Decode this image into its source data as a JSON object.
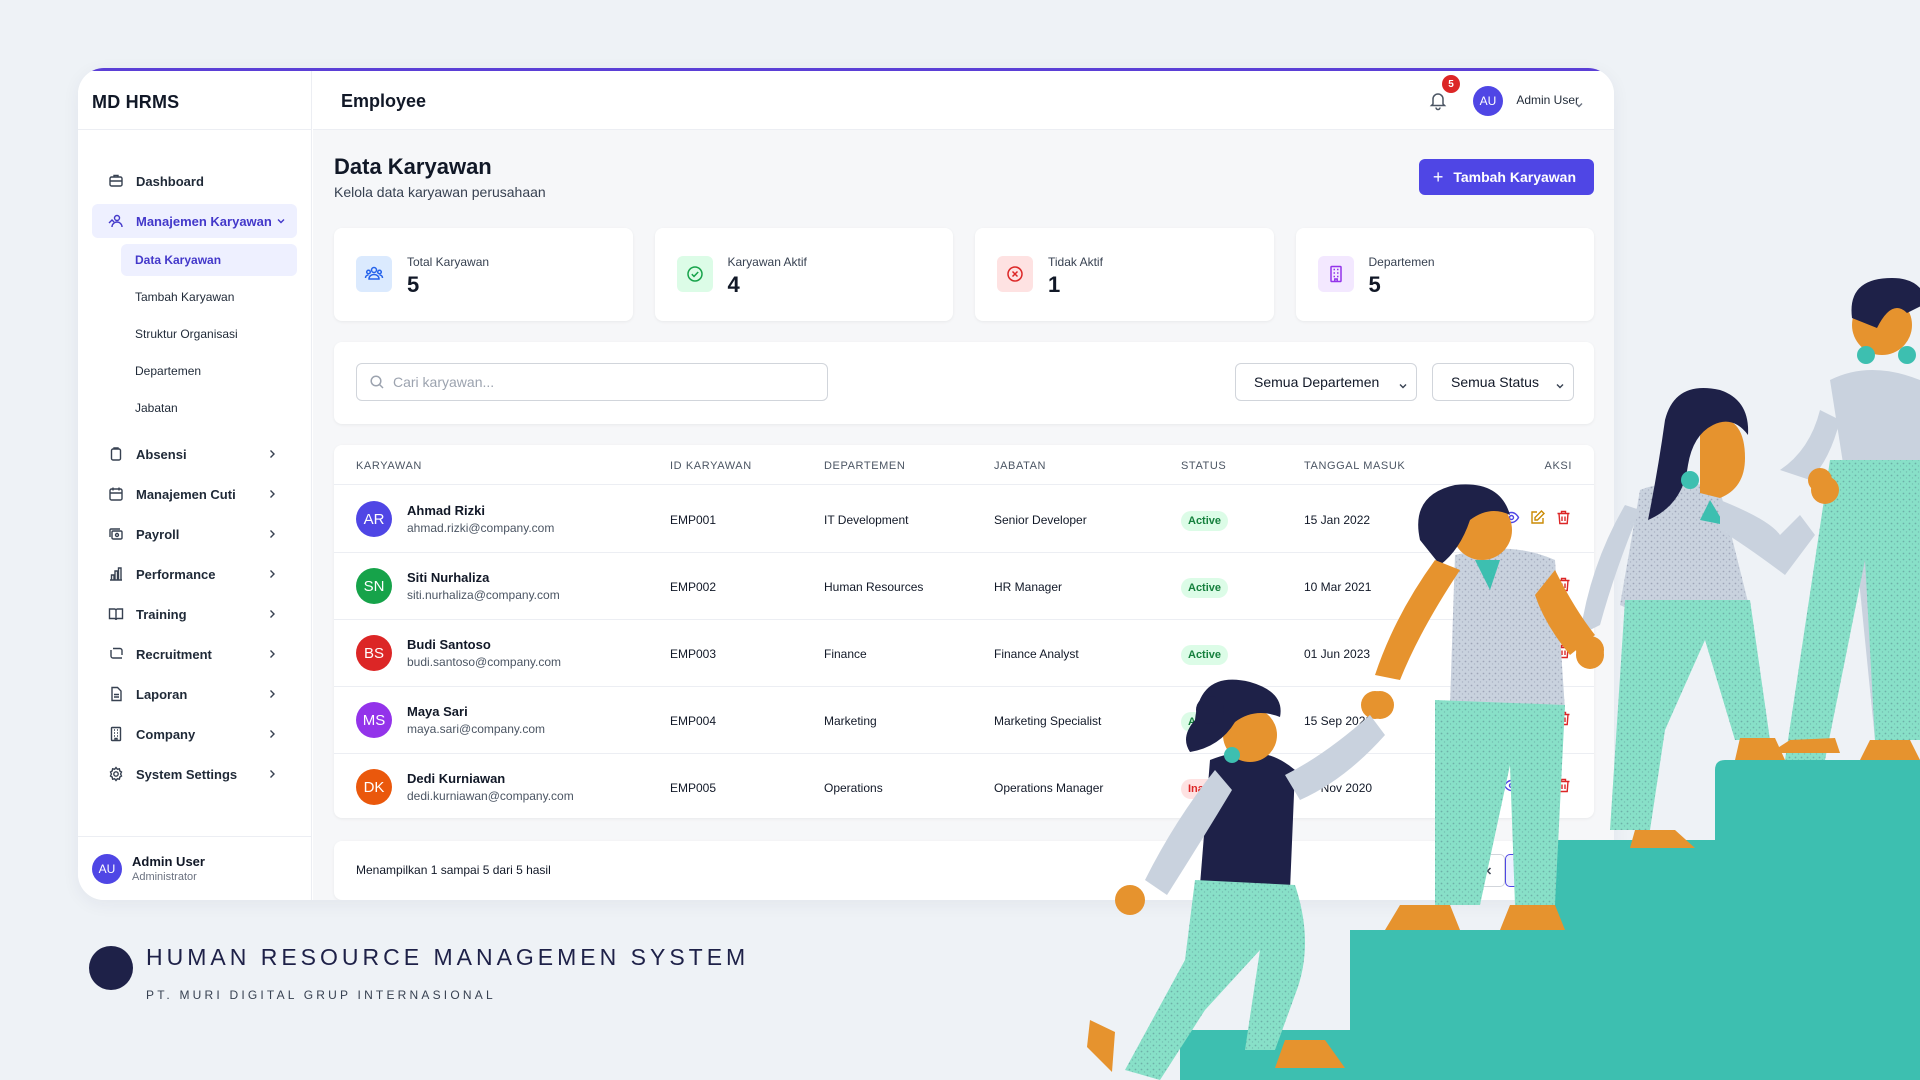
{
  "app": {
    "brand": "MD HRMS",
    "page_header": "Employee",
    "notifications_count": "5",
    "user_initials": "AU",
    "user_name": "Admin User",
    "user_role": "Administrator"
  },
  "sidebar": {
    "items": [
      {
        "label": "Dashboard",
        "icon": "dashboard-icon"
      },
      {
        "label": "Manajemen Karyawan",
        "icon": "users-manage-icon"
      },
      {
        "label": "Absensi",
        "icon": "clipboard-icon"
      },
      {
        "label": "Manajemen Cuti",
        "icon": "calendar-icon"
      },
      {
        "label": "Payroll",
        "icon": "money-icon"
      },
      {
        "label": "Performance",
        "icon": "bar-chart-icon"
      },
      {
        "label": "Training",
        "icon": "book-icon"
      },
      {
        "label": "Recruitment",
        "icon": "recruit-icon"
      },
      {
        "label": "Laporan",
        "icon": "document-icon"
      },
      {
        "label": "Company",
        "icon": "building-icon"
      },
      {
        "label": "System Settings",
        "icon": "gear-icon"
      }
    ],
    "sub_items": [
      "Data Karyawan",
      "Tambah Karyawan",
      "Struktur Organisasi",
      "Departemen",
      "Jabatan"
    ]
  },
  "page": {
    "title": "Data Karyawan",
    "subtitle": "Kelola data karyawan perusahaan",
    "add_button": "Tambah Karyawan"
  },
  "stats": [
    {
      "label": "Total Karyawan",
      "value": "5",
      "color": "#2563eb",
      "bg": "#dbeafe"
    },
    {
      "label": "Karyawan Aktif",
      "value": "4",
      "color": "#16a34a",
      "bg": "#dcfce7"
    },
    {
      "label": "Tidak Aktif",
      "value": "1",
      "color": "#dc2626",
      "bg": "#fee2e2"
    },
    {
      "label": "Departemen",
      "value": "5",
      "color": "#9333ea",
      "bg": "#f3e8ff"
    }
  ],
  "filters": {
    "search_placeholder": "Cari karyawan...",
    "department": "Semua Departemen",
    "status": "Semua Status"
  },
  "table": {
    "headers": {
      "employee": "KARYAWAN",
      "id": "ID KARYAWAN",
      "department": "DEPARTEMEN",
      "position": "JABATAN",
      "status": "STATUS",
      "join_date": "TANGGAL MASUK",
      "actions": "AKSI"
    },
    "rows": [
      {
        "initials": "AR",
        "name": "Ahmad Rizki",
        "email": "ahmad.rizki@company.com",
        "id": "EMP001",
        "department": "IT Development",
        "position": "Senior Developer",
        "status": "Active",
        "join_date": "15 Jan 2022",
        "color": "#4f46e5"
      },
      {
        "initials": "SN",
        "name": "Siti Nurhaliza",
        "email": "siti.nurhaliza@company.com",
        "id": "EMP002",
        "department": "Human Resources",
        "position": "HR Manager",
        "status": "Active",
        "join_date": "10 Mar 2021",
        "color": "#16a34a"
      },
      {
        "initials": "BS",
        "name": "Budi Santoso",
        "email": "budi.santoso@company.com",
        "id": "EMP003",
        "department": "Finance",
        "position": "Finance Analyst",
        "status": "Active",
        "join_date": "01 Jun 2023",
        "color": "#dc2626"
      },
      {
        "initials": "MS",
        "name": "Maya Sari",
        "email": "maya.sari@company.com",
        "id": "EMP004",
        "department": "Marketing",
        "position": "Marketing Specialist",
        "status": "Active",
        "join_date": "15 Sep 2022",
        "color": "#9333ea"
      },
      {
        "initials": "DK",
        "name": "Dedi Kurniawan",
        "email": "dedi.kurniawan@company.com",
        "id": "EMP005",
        "department": "Operations",
        "position": "Operations Manager",
        "status": "Inactive",
        "join_date": "20 Nov 2020",
        "color": "#ea580c"
      }
    ]
  },
  "pagination": {
    "summary": "Menampilkan 1 sampai 5 dari 5 hasil",
    "current_page": "1"
  },
  "footer": {
    "title": "HUMAN RESOURCE MANAGEMEN SYSTEM",
    "subtitle": "PT. MURI DIGITAL GRUP INTERNASIONAL"
  }
}
